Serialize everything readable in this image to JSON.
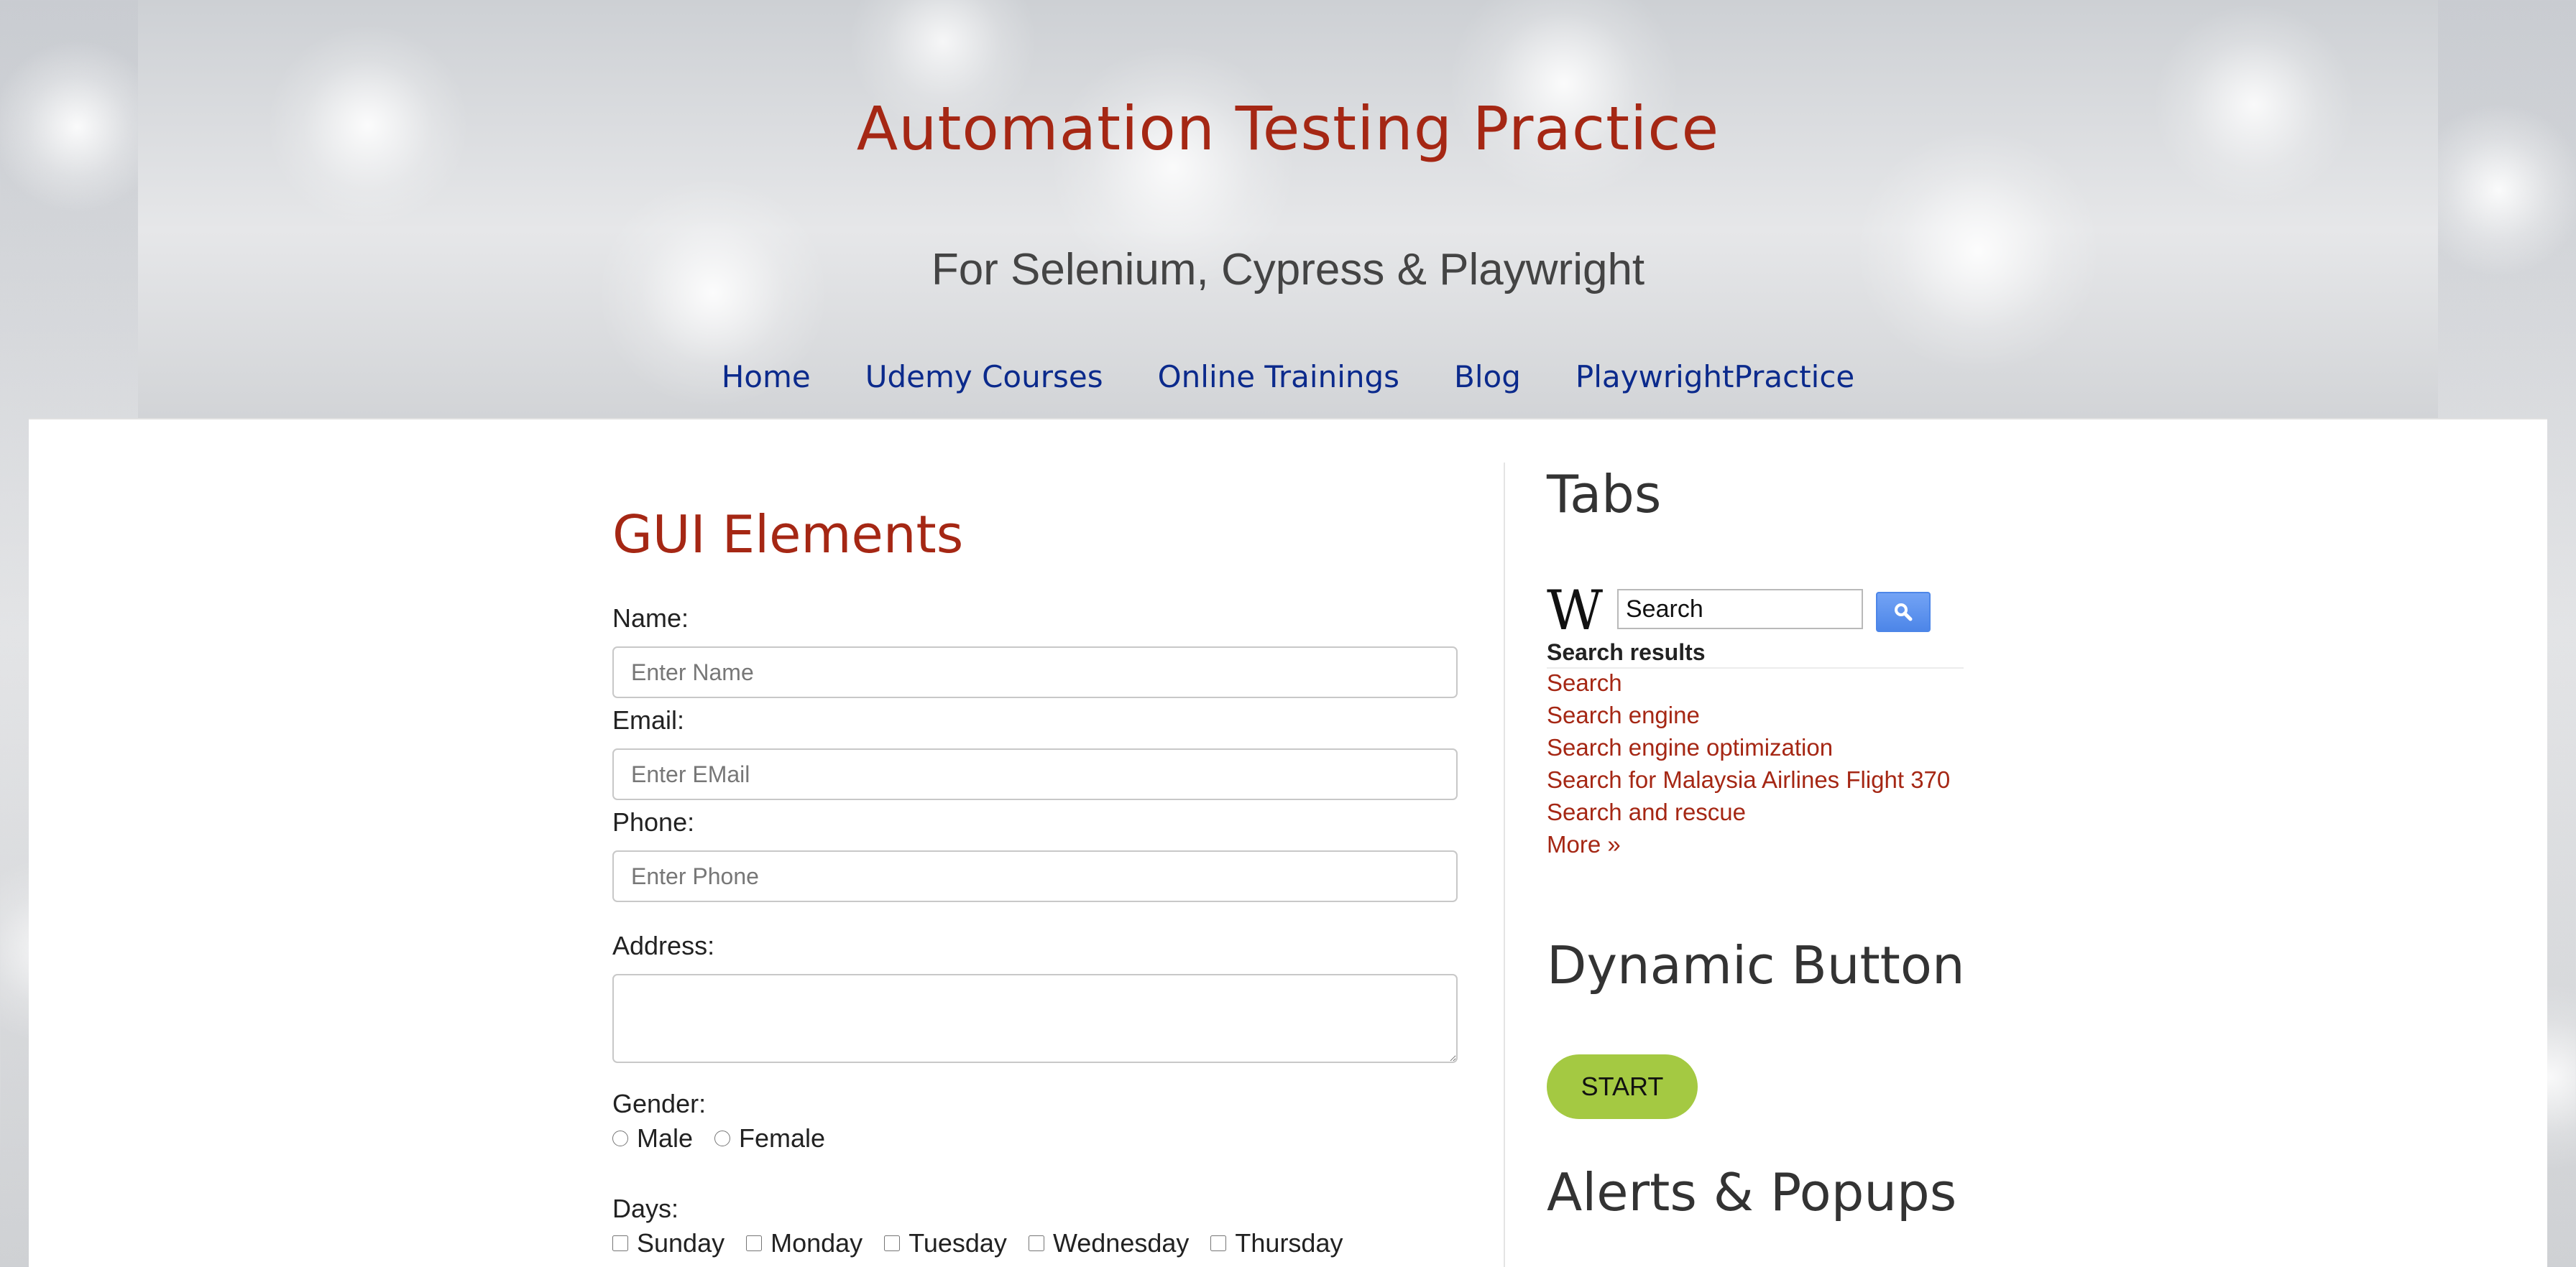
{
  "header": {
    "title": "Automation Testing Practice",
    "subtitle": "For Selenium, Cypress & Playwright",
    "nav": [
      "Home",
      "Udemy Courses",
      "Online Trainings",
      "Blog",
      "PlaywrightPractice"
    ]
  },
  "gui": {
    "title": "GUI Elements",
    "name_label": "Name:",
    "name_placeholder": "Enter Name",
    "email_label": "Email:",
    "email_placeholder": "Enter EMail",
    "phone_label": "Phone:",
    "phone_placeholder": "Enter Phone",
    "address_label": "Address:",
    "gender_label": "Gender:",
    "genders": [
      "Male",
      "Female"
    ],
    "days_label": "Days:",
    "days": [
      "Sunday",
      "Monday",
      "Tuesday",
      "Wednesday",
      "Thursday"
    ]
  },
  "tabs": {
    "title": "Tabs",
    "wiki_logo": "W",
    "search_value": "Search",
    "search_icon": "magnifier-icon",
    "results_heading": "Search results",
    "results": [
      "Search",
      "Search engine",
      "Search engine optimization",
      "Search for Malaysia Airlines Flight 370",
      "Search and rescue",
      "More »"
    ]
  },
  "dynamic_button": {
    "title": "Dynamic Button",
    "label": "START"
  },
  "alerts": {
    "title": "Alerts & Popups"
  },
  "colors": {
    "title_red": "#a52714",
    "nav_blue": "#0b2a8c",
    "start_green": "#a4c942",
    "search_btn_blue": "#4d86e8"
  }
}
